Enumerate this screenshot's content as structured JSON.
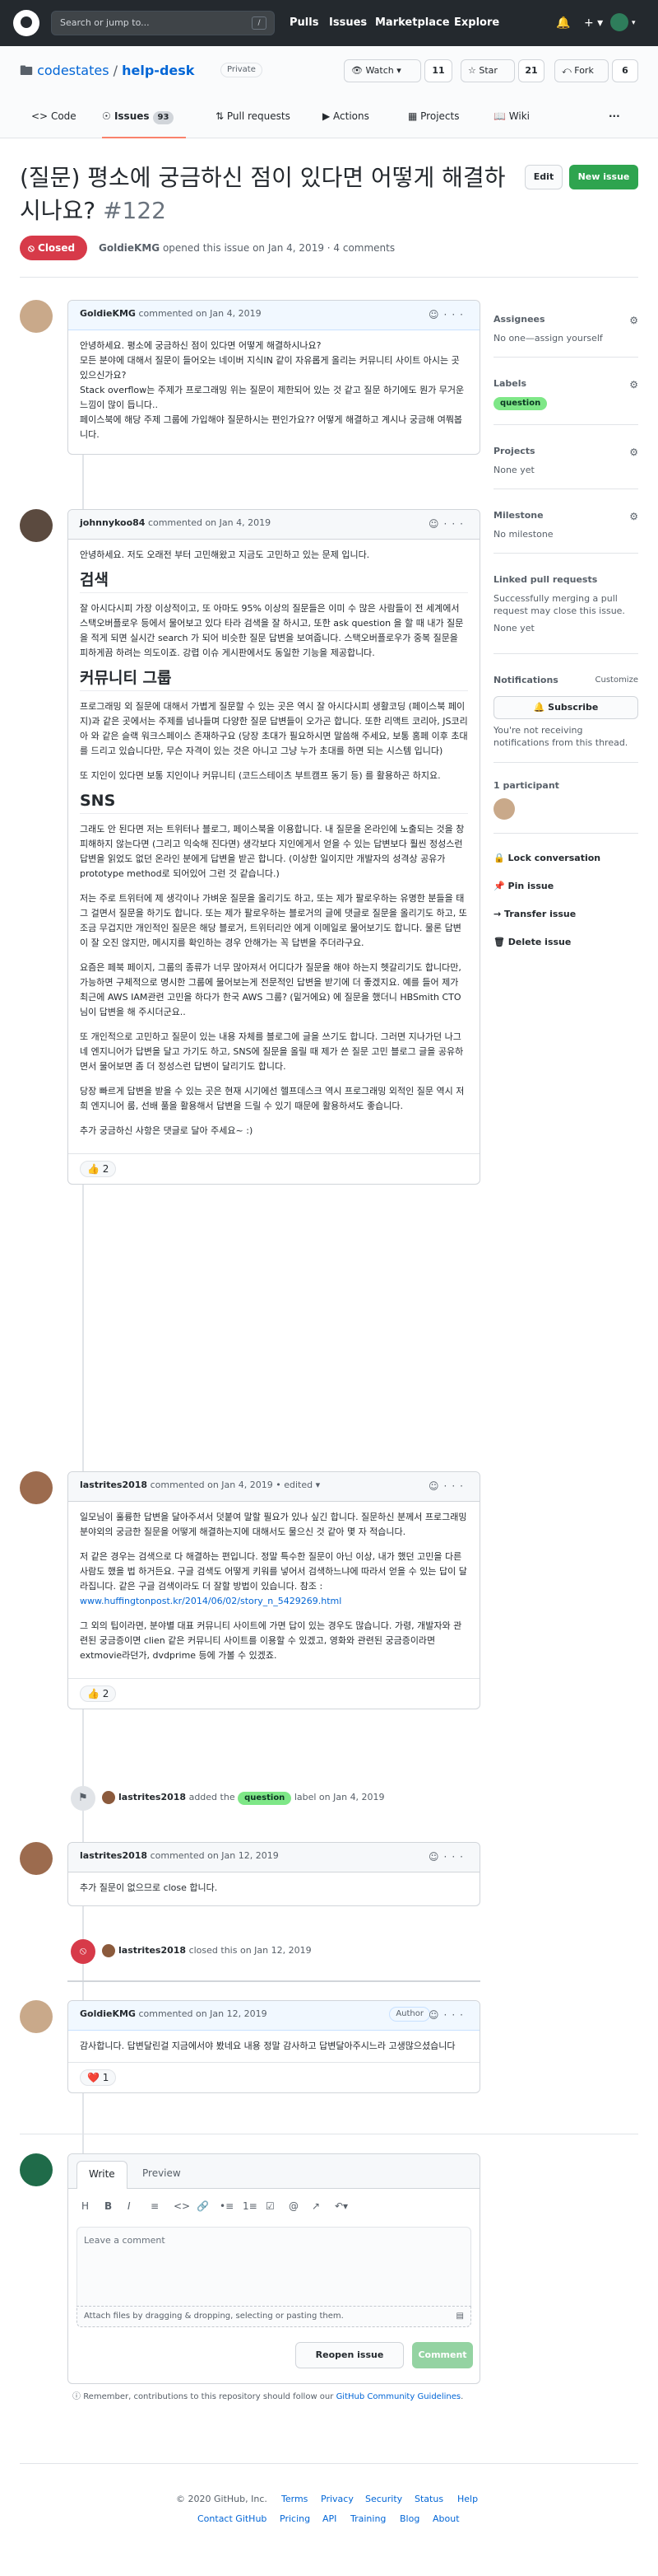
{
  "header": {
    "search_placeholder": "Search or jump to...",
    "slash_key": "/",
    "nav": [
      "Pulls",
      "Issues",
      "Marketplace",
      "Explore"
    ],
    "icons": [
      "github-logo",
      "bell-icon",
      "plus-icon",
      "avatar"
    ]
  },
  "repo": {
    "owner": "codestates",
    "separator": "/",
    "name": "help-desk",
    "visibility": "Private",
    "watch_label": "Watch",
    "watch_count": "11",
    "star_label": "Star",
    "star_count": "21",
    "fork_label": "Fork",
    "fork_count": "6",
    "more": "···"
  },
  "tabs": [
    {
      "label": "Code"
    },
    {
      "label": "Issues",
      "count": "93"
    },
    {
      "label": "Pull requests"
    },
    {
      "label": "Actions"
    },
    {
      "label": "Projects"
    },
    {
      "label": "Wiki"
    }
  ],
  "issue": {
    "title": "(질문) 평소에 궁금하신 점이 있다면 어떻게 해결하시나요?",
    "number": "#122",
    "edit_label": "Edit",
    "new_issue_label": "New issue",
    "state": "Closed",
    "author": "GoldieKMG",
    "meta_text": "opened this issue on Jan 4, 2019 · 4 comments"
  },
  "comments": [
    {
      "author": "GoldieKMG",
      "when": "commented on Jan 4, 2019",
      "paragraphs": [
        "안녕하세요. 평소에 궁금하신 점이 있다면 어떻게 해결하시나요?",
        "모든 분야에 대해서 질문이 들어오는 네이버 지식IN 같이 자유롭게 올리는 커뮤니티 사이트 아시는 곳 있으신가요?",
        "Stack overflow는 주제가 프로그래밍 위는 질문이 제한되어 있는 것 같고 질문 하기에도 뭔가 무거운 느낌이 많이 듭니다..",
        "페이스북에 해당 주제 그룹에 가입해야 질문하시는 편인가요?? 어떻게 해결하고 계시나 궁금해 여쭤봅니다."
      ]
    },
    {
      "author": "johnnykoo84",
      "when": "commented on Jan 4, 2019",
      "intro": "안녕하세요. 저도 오래전 부터 고민해왔고 지금도 고민하고 있는 문제 입니다.",
      "h_search": "검색",
      "p_search": "잘 아시다시피 가장 이상적이고, 또 아마도 95% 이상의 질문들은 이미 수 많은 사람들이 전 세계에서 스택오버플로우 등에서 물어보고 있다 타라 검색을 잘 하시고, 또한 ask question 을 할 때 내가 질문을 적게 되면 실시간 search 가 되어 비슷한 질문 답변을 보여줍니다. 스택오버플로우가 중복 질문을 피하게끔 하려는 의도이죠. 강렵 이슈 게시판에서도 동일한 기능을 제공합니다.",
      "h_community": "커뮤니티 그룹",
      "p_community_1": "프로그래밍 외 질문에 대해서 가볍게 질문할 수 있는 곳은 역시 잘 아시다시피 생활코딩 (페이스북 페이지)과 같은 곳에서는 주제를 넘나들며 다양한 질문 답변들이 오가곤 합니다. 또한 리액트 코리아, JS코리아 와 같은 슬랙 워크스페이스 존재하구요 (당장 초대가 필요하시면 말씀해 주세요, 보통 홈페 이후 초대를 드리고 있습니다만, 무슨 자격이 있는 것은 아니고 그냥 누가 초대를 하면 되는 시스템 입니다)",
      "p_community_2": "또 지인이 있다면 보통 지인이나 커뮤니티 (코드스테이츠 부트캠프 동기 등) 를 활용하곤 하지요.",
      "h_sns": "SNS",
      "p_sns_1": "그래도 안 된다면 저는 트위터나 블로그, 페이스북을 이용합니다. 내 질문을 온라인에 노출되는 것을 창피해하지 않는다면 (그리고 익숙해 진다면) 생각보다 지인에게서 얻을 수 있는 답변보다 훨씬 정성스런 답변을 읽었도 없던 온라인 분에게 답변을 받곤 합니다. (이상한 일이지만 개발자의 성격상 공유가 prototype method로 되어있어 그런 것 같습니다.)",
      "p_sns_2": "저는 주로 트위터에 제 생각이나 가벼운 질문을 올리기도 하고, 또는 제가 팔로우하는 유명한 분들을 태그 걸면서 질문을 하기도 합니다. 또는 제가 팔로우하는 블로거의 글에 댓글로 질문을 올리기도 하고, 또 조금 무겁지만 개인적인 질문은 해당 블로거, 트위터리안 에게 이메일로 물어보기도 합니다. 물론 답변이 잘 오진 않지만, 메시지를 확인하는 경우 안해가는 꼭 답변을 주더라구요.",
      "p_sns_3": "요즘은 페북 페이지, 그룹의 종류가 너무 많아져서 어디다가 질문을 해야 하는지 헷갈리기도 합니다만, 가능하면 구체적으로 명시한 그룹에 물어보는게 전문적인 답변을 받기에 더 좋겠지요. 예를 들어 제가 최근에 AWS IAM관련 고민을 하다가 한국 AWS 그룹? (밑거에요) 에 질문을 했더니 HBSmith CTO님이 답변을 해 주시더군요..",
      "p_sns_4": "또 개인적으로 고민하고 질문이 있는 내용 자체를 블로그에 글을 쓰기도 합니다. 그러면 지나가던 나그네 엔지니어가 답변을 달고 가기도 하고, SNS에 질문을 올릴 때 제가 쓴 질문 고민 블로그 글을 공유하면서 물어보면 좀 더 정성스런 답변이 달리기도 합니다.",
      "p_sns_5": "당장 빠르게 답변을 받을 수 있는 곳은 현재 시기에선 헬프데스크 역시 프로그래밍 외적인 질문 역시 저희 엔지니어 룸, 선배 풀을 활용해서 답변을 드릴 수 있기 때문에 활용하셔도 좋습니다.",
      "p_outro": "추가 궁금하신 사항은 댓글로 달아 주세요~ :)",
      "reaction_emoji": "👍",
      "reaction_count": "2"
    },
    {
      "author": "lastrites2018",
      "when": "commented on Jan 4, 2019 • edited",
      "p1": "일모님이 훌륭한 답변을 달아주셔서 덧붙여 말할 필요가 있나 싶긴 합니다. 질문하신 분께서 프로그래밍 분야외의 궁금한 질문을 어떻게 해결하는지에 대해서도 물으신 것 같아 몇 자 적습니다.",
      "p2": "저 같은 경우는 검색으로 다 해결하는 편입니다. 정말 특수한 질문이 아닌 이상, 내가 했던 고민을 다른 사람도 했을 법 하거든요. 구글 검색도 어떻게 키워를 넣어서 검색하느냐에 따라서 얻을 수 있는 답이 달라집니다. 같은 구글 검색이라도 더 잘할 방법이 있습니다. 참조 : ",
      "p2_link": "www.huffingtonpost.kr/2014/06/02/story_n_5429269.html",
      "p3": "그 외의 팁이라면, 분야별 대표 커뮤니티 사이트에 가면 답이 있는 경우도 많습니다. 가령, 개발자와 관련된 궁금증이면 clien 같은 커뮤니티 사이트를 이용할 수 있겠고, 영화와 관련된 궁금증이라면 extmovie라던가, dvdprime 등에 가볼 수 있겠죠.",
      "reaction_emoji": "👍",
      "reaction_count": "2"
    },
    {
      "author": "lastrites2018",
      "when": "commented on Jan 12, 2019",
      "body": "추가 질문이 없으므로 close 합니다."
    },
    {
      "author": "GoldieKMG",
      "when": "commented on Jan 12, 2019",
      "author_badge": "Author",
      "body": "감사합니다. 답변달린걸 지금에서야 봤네요 내용 정말 감사하고 답변달아주시느라 고생많으셨습니다",
      "reaction_emoji": "❤️",
      "reaction_count": "1"
    }
  ],
  "events": {
    "label_event": {
      "actor": "lastrites2018",
      "before": "added the",
      "label": "question",
      "after": "label on Jan 4, 2019"
    },
    "close_event": {
      "actor": "lastrites2018",
      "text": "closed this on Jan 12, 2019"
    }
  },
  "sidebar": {
    "assignees": {
      "title": "Assignees",
      "value": "No one—assign yourself"
    },
    "labels": {
      "title": "Labels",
      "value": "question"
    },
    "projects": {
      "title": "Projects",
      "value": "None yet"
    },
    "milestone": {
      "title": "Milestone",
      "value": "No milestone"
    },
    "linked": {
      "title": "Linked pull requests",
      "desc": "Successfully merging a pull request may close this issue.",
      "value": "None yet"
    },
    "notifications": {
      "title": "Notifications",
      "customize": "Customize",
      "subscribe": "Subscribe",
      "desc": "You're not receiving notifications from this thread."
    },
    "participants": {
      "title": "1 participant"
    },
    "actions": [
      "Lock conversation",
      "Pin issue",
      "Transfer issue",
      "Delete issue"
    ]
  },
  "composer": {
    "tab_write": "Write",
    "tab_preview": "Preview",
    "placeholder": "Leave a comment",
    "attach": "Attach files by dragging & dropping, selecting or pasting them.",
    "reopen": "Reopen issue",
    "submit": "Comment"
  },
  "guidelines": {
    "text": "Remember, contributions to this repository should follow our ",
    "link": "GitHub Community Guidelines",
    "end": "."
  },
  "footer": {
    "row1": [
      "© 2020 GitHub, Inc.",
      "Terms",
      "Privacy",
      "Security",
      "Status",
      "Help"
    ],
    "row2": [
      "Contact GitHub",
      "Pricing",
      "API",
      "Training",
      "Blog",
      "About"
    ]
  },
  "colors": {
    "closed": "#d73a49",
    "primary": "#2ea44f",
    "label_question": "#7ee787",
    "link": "#0366d6"
  }
}
